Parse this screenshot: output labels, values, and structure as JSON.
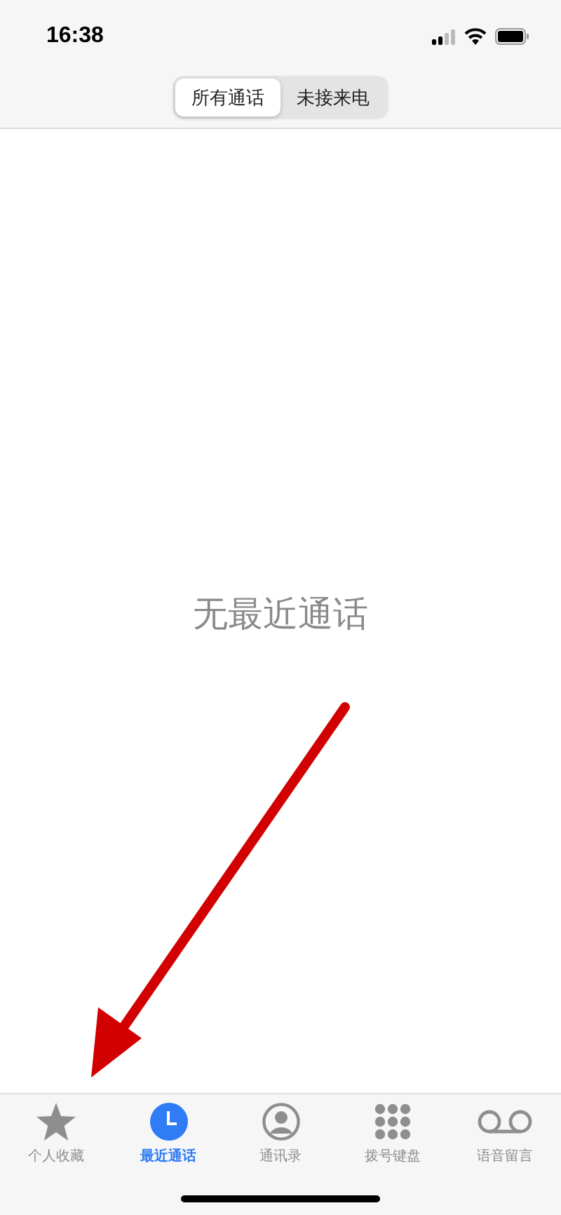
{
  "status_bar": {
    "time": "16:38"
  },
  "segments": [
    {
      "label": "所有通话",
      "selected": true
    },
    {
      "label": "未接来电",
      "selected": false
    }
  ],
  "empty_message": "无最近通话",
  "annotation": {
    "kind": "arrow"
  },
  "tab_bar": [
    {
      "label": "个人收藏",
      "kind": "star",
      "selected": false
    },
    {
      "label": "最近通话",
      "kind": "clock",
      "selected": true
    },
    {
      "label": "通讯录",
      "kind": "person",
      "selected": false
    },
    {
      "label": "拨号键盘",
      "kind": "keypad",
      "selected": false
    },
    {
      "label": "语音留言",
      "kind": "voicemail",
      "selected": false
    }
  ]
}
